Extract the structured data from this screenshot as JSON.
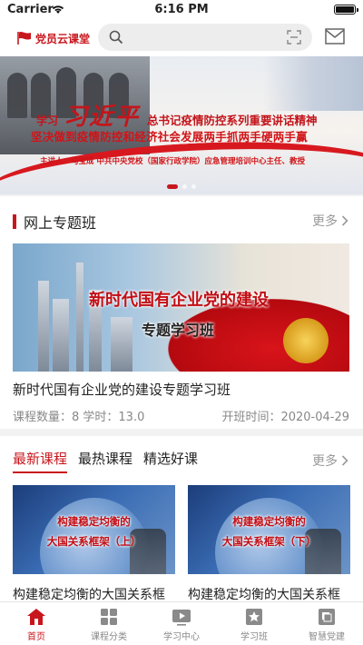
{
  "status_bar": {
    "carrier": "Carrier",
    "time": "6:16 PM"
  },
  "header": {
    "logo_text": "党员云课堂"
  },
  "banner": {
    "prefix": "学习",
    "signature": "习近平",
    "headline": "总书记疫情防控系列重要讲话精神",
    "line2": "坚决做到疫情防控和经济社会发展两手抓两手硬两手赢",
    "lecturer": "主讲人：马宝成  中共中央党校（国家行政学院）应急管理培训中心主任、教授"
  },
  "section_online": {
    "title": "网上专题班",
    "more": "更多",
    "image_title_1": "新时代国有企业党的建设",
    "image_title_2": "专题学习班",
    "course_name": "新时代国有企业党的建设专题学习班",
    "meta": "课程数量：8  学时：13.0",
    "start": "开班时间：2020-04-29"
  },
  "section_courses": {
    "tabs": [
      "最新课程",
      "最热课程",
      "精选好课"
    ],
    "more": "更多",
    "courses": [
      {
        "thumb_1": "构建稳定均衡的",
        "thumb_2": "大国关系框架（上）",
        "name": "构建稳定均衡的大国关系框"
      },
      {
        "thumb_1": "构建稳定均衡的",
        "thumb_2": "大国关系框架（下）",
        "name": "构建稳定均衡的大国关系框"
      }
    ]
  },
  "tabbar": {
    "items": [
      {
        "label": "首页",
        "icon": "home-icon"
      },
      {
        "label": "课程分类",
        "icon": "grid-icon"
      },
      {
        "label": "学习中心",
        "icon": "play-icon"
      },
      {
        "label": "学习班",
        "icon": "star-icon"
      },
      {
        "label": "智慧党建",
        "icon": "book-icon"
      }
    ]
  },
  "colors": {
    "accent": "#c8161d"
  }
}
